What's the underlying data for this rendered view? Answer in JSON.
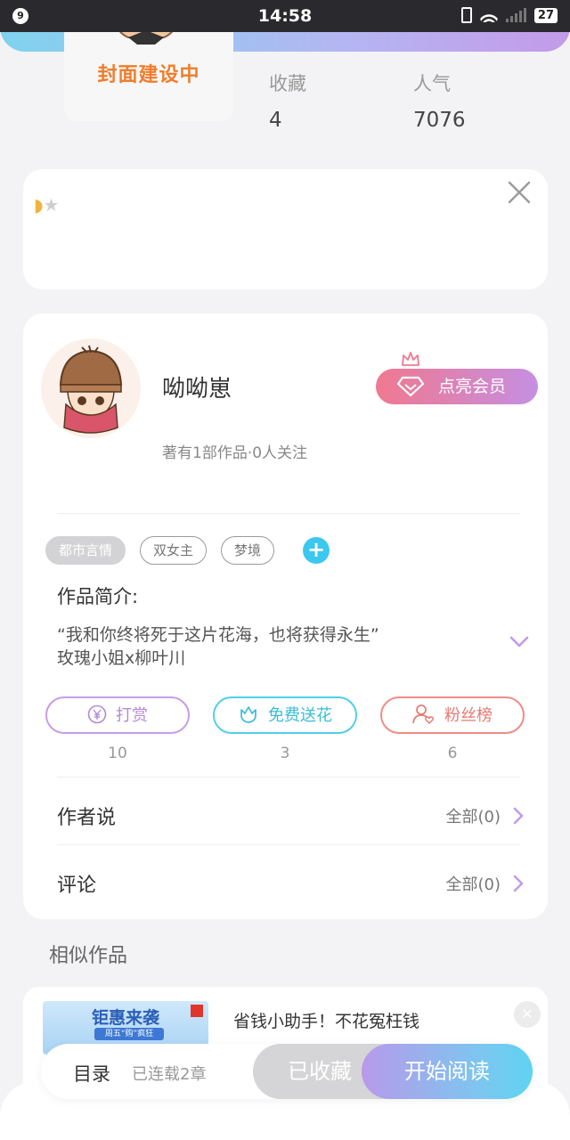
{
  "status_bar": {
    "notification_count": "9",
    "time": "14:58",
    "battery": "27"
  },
  "cover": {
    "placeholder_text": "封面建设中"
  },
  "stats": [
    {
      "label": "收藏",
      "value": "4"
    },
    {
      "label": "人气",
      "value": "7076"
    }
  ],
  "rating": {
    "stars_filled": 1,
    "stars_total": 5
  },
  "author": {
    "name": "呦呦崽",
    "meta": "著有1部作品·0人关注",
    "vip_label": "点亮会员"
  },
  "tags": [
    {
      "label": "都市言情",
      "active": true
    },
    {
      "label": "双女主",
      "active": false
    },
    {
      "label": "梦境",
      "active": false
    }
  ],
  "intro": {
    "title": "作品简介:",
    "line1": "“我和你终将死于这片花海，也将获得永生”",
    "line2": "玫瑰小姐x柳叶川"
  },
  "actions": [
    {
      "label": "打赏",
      "count": "10"
    },
    {
      "label": "免费送花",
      "count": "3"
    },
    {
      "label": "粉丝榜",
      "count": "6"
    }
  ],
  "author_says": {
    "title": "作者说",
    "link": "全部(0)"
  },
  "comments": {
    "title": "评论",
    "link": "全部(0)"
  },
  "similar": {
    "title": "相似作品",
    "ad": {
      "image_title": "钜惠来袭",
      "image_ribbon": "周五“购”疯狂",
      "text": "省钱小助手！不花冤枉钱"
    }
  },
  "bottom": {
    "toc": "目录",
    "toc_sub": "已连载2章",
    "collected": "已收藏",
    "read": "开始阅读"
  },
  "colors": {
    "cover_text": "#f07d2c",
    "tag_add": "#3cc8ee",
    "reward": "#b48ad8",
    "flower": "#3cbcd8",
    "fans": "#e77a73"
  }
}
